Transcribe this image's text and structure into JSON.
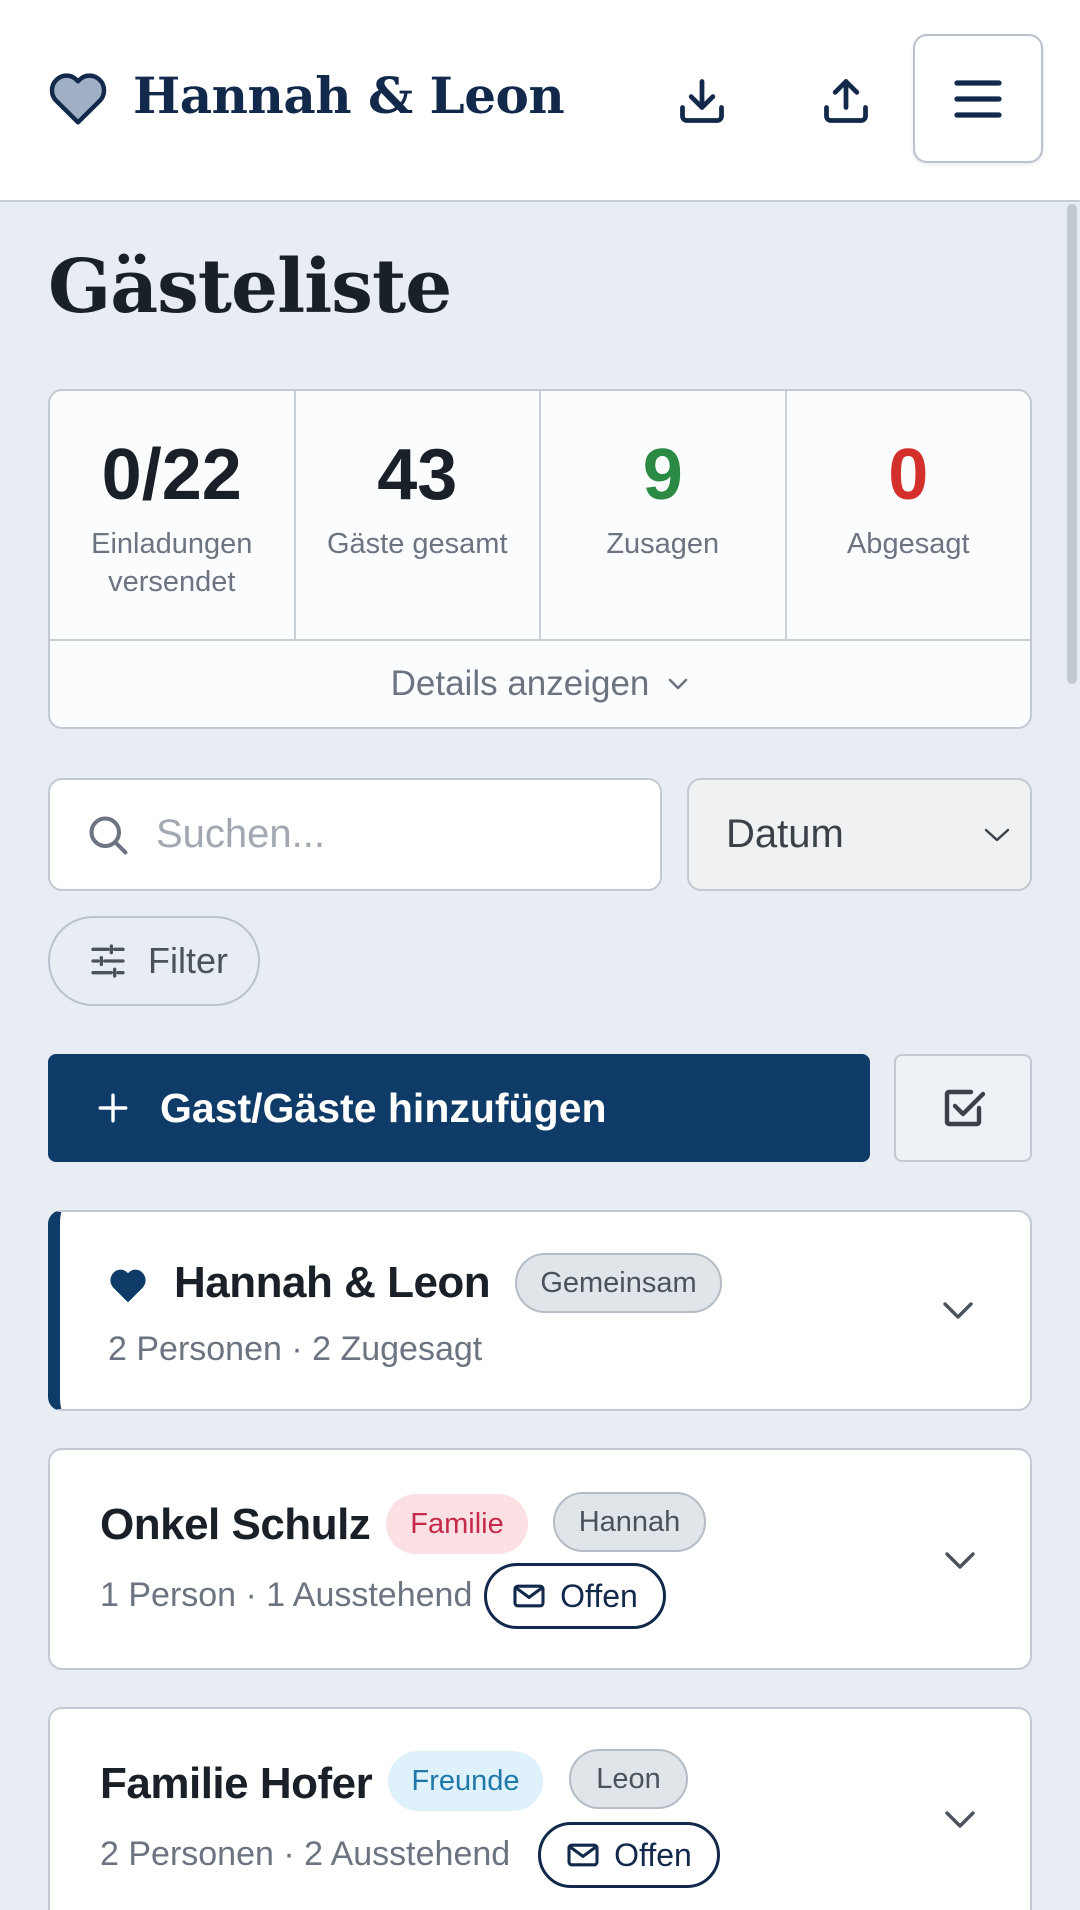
{
  "header": {
    "title": "Hannah & Leon",
    "icons": [
      "heart-icon",
      "download-icon",
      "upload-icon",
      "menu-icon"
    ]
  },
  "page": {
    "title": "Gästeliste"
  },
  "stats": {
    "items": [
      {
        "value": "0/22",
        "label": "Einladungen versendet",
        "color": "#1a2027"
      },
      {
        "value": "43",
        "label": "Gäste gesamt",
        "color": "#1a2027"
      },
      {
        "value": "9",
        "label": "Zusagen",
        "color": "#2a8a43"
      },
      {
        "value": "0",
        "label": "Abgesagt",
        "color": "#d4302b"
      }
    ],
    "details_label": "Details anzeigen"
  },
  "search": {
    "placeholder": "Suchen...",
    "value": ""
  },
  "sort": {
    "selected": "Datum"
  },
  "filter": {
    "label": "Filter"
  },
  "actions": {
    "add_label": "Gast/Gäste hinzufügen"
  },
  "groups": [
    {
      "name": "Hannah & Leon",
      "tags": [
        "Gemeinsam"
      ],
      "summary": "2 Personen · 2 Zugesagt",
      "status": ""
    },
    {
      "name": "Onkel Schulz",
      "tags": [
        "Familie",
        "Hannah"
      ],
      "summary": "1 Person · 1 Ausstehend",
      "status": "Offen"
    },
    {
      "name": "Familie Hofer",
      "tags": [
        "Freunde",
        "Leon"
      ],
      "summary": "2 Personen · 2 Ausstehend",
      "status": "Offen"
    }
  ],
  "colors": {
    "primary": "#0f3b68",
    "accent_green": "#2a8a43",
    "accent_red": "#d4302b",
    "tag_family": "#c62a4a",
    "tag_friends": "#1f78a8"
  }
}
